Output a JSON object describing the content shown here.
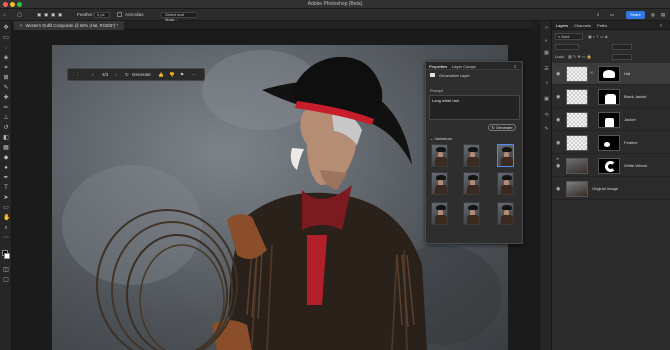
{
  "window": {
    "title": "Adobe Photoshop (Beta)"
  },
  "options_bar": {
    "feather_label": "Feather:",
    "feather_value": "0 px",
    "anti_alias_label": "Anti-alias",
    "select_label": "Select and Mask...",
    "share_label": "Share"
  },
  "document": {
    "tab_title": "Western Outfit Composite @ 66% (Hat, RGB/8*) *"
  },
  "task_bar": {
    "counter": "3/3",
    "generate_label": "Generate"
  },
  "properties": {
    "tab_properties": "Properties",
    "tab_layer_comps": "Layer Comps",
    "layer_type": "Generative Layer",
    "prompt_label": "Prompt",
    "prompt_value": "Long white hair",
    "generate_label": "Generate",
    "variations_label": "Variations",
    "selected_variation": 3
  },
  "layers_panel": {
    "tabs": [
      "Layers",
      "Channels",
      "Paths"
    ],
    "kind_label": "Kind",
    "lock_label": "Lock:",
    "layers": [
      {
        "name": "Hat",
        "selected": true
      },
      {
        "name": "Black Jacket",
        "selected": false
      },
      {
        "name": "Jacket",
        "selected": false
      },
      {
        "name": "Feather",
        "selected": false
      },
      {
        "name": "White Wheat",
        "selected": false
      },
      {
        "name": "Original Image",
        "selected": false
      }
    ]
  },
  "colors": {
    "accent": "#2f77e6",
    "hat_band": "#c81e2b"
  }
}
